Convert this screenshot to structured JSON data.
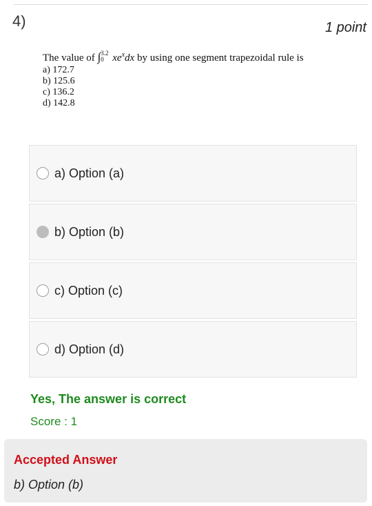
{
  "question": {
    "number": "4)",
    "points": "1 point",
    "text_before": "The value of ",
    "integral_symbol": "∫",
    "upper_limit": "3.2",
    "lower_limit": "0",
    "integrand_x": "xe",
    "integrand_exp": "x",
    "integrand_dx": "dx",
    "text_after": " by using one segment trapezoidal rule is",
    "choices": [
      "a) 172.7",
      "b) 125.6",
      "c) 136.2",
      "d) 142.8"
    ]
  },
  "options": [
    {
      "label": "a) Option (a)",
      "selected": false
    },
    {
      "label": "b) Option (b)",
      "selected": true
    },
    {
      "label": "c) Option (c)",
      "selected": false
    },
    {
      "label": "d) Option (d)",
      "selected": false
    }
  ],
  "feedback": {
    "result": "Yes, The answer is correct",
    "score": "Score : 1"
  },
  "accepted": {
    "title": "Accepted Answer",
    "answer": "b) Option (b)"
  },
  "colors": {
    "correct_green": "#1e8a1e",
    "accepted_red": "#d0101a",
    "panel_gray": "#ececec"
  }
}
